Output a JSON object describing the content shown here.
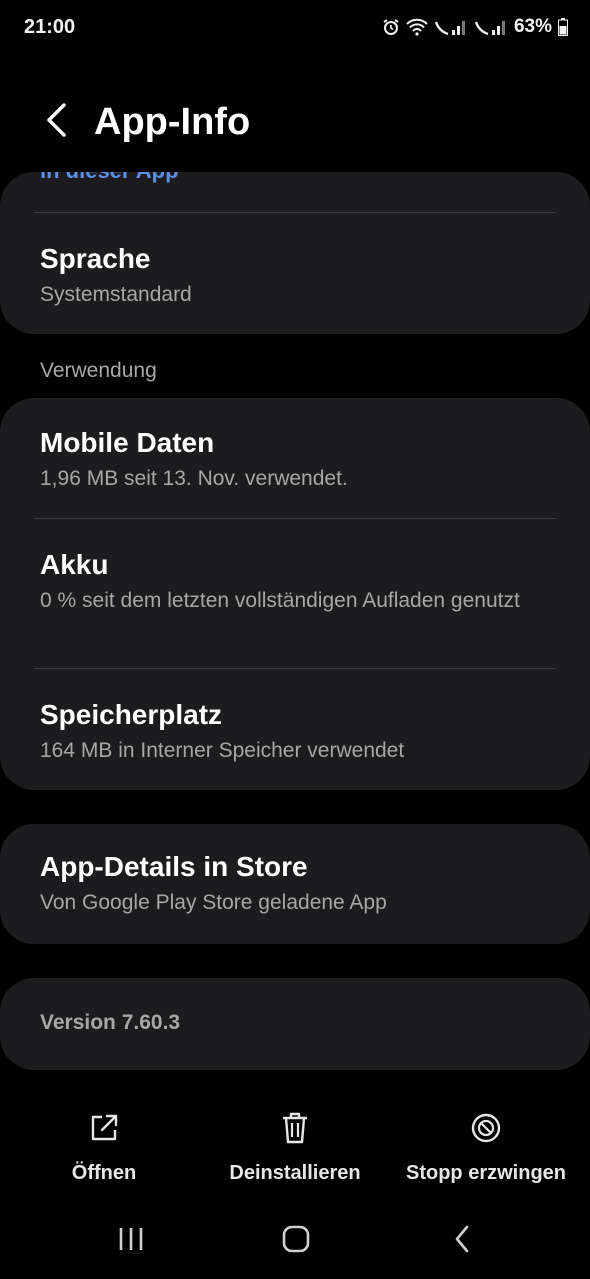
{
  "status_bar": {
    "time": "21:00",
    "battery": "63%",
    "icons": [
      "alarm-icon",
      "wifi-icon",
      "volte-signal-icon",
      "volte-signal-icon",
      "battery-icon"
    ]
  },
  "header": {
    "title": "App-Info",
    "back_icon": "chevron-left-icon"
  },
  "card_top": {
    "cut_link": "in dieser App",
    "language": {
      "title": "Sprache",
      "subtitle": "Systemstandard"
    }
  },
  "usage": {
    "header": "Verwendung",
    "items": [
      {
        "title": "Mobile Daten",
        "subtitle": "1,96 MB seit 13. Nov. verwendet."
      },
      {
        "title": "Akku",
        "subtitle": "0 % seit dem letzten vollständigen Aufladen genutzt"
      },
      {
        "title": "Speicherplatz",
        "subtitle": "164 MB in Interner Speicher verwendet"
      }
    ]
  },
  "store": {
    "title": "App-Details in Store",
    "subtitle": "Von Google Play Store geladene App"
  },
  "version": "Version 7.60.3",
  "bottom_actions": [
    {
      "label": "Öffnen",
      "icon": "open-external-icon"
    },
    {
      "label": "Deinstallieren",
      "icon": "trash-icon"
    },
    {
      "label": "Stopp erzwingen",
      "icon": "block-icon"
    }
  ],
  "nav_bar": {
    "icons": [
      "recent-apps-icon",
      "home-icon",
      "back-icon"
    ]
  },
  "colors": {
    "background": "#000000",
    "card": "#1c1c1e",
    "link": "#5b8fe8",
    "secondary_text": "#a7a7a7"
  }
}
